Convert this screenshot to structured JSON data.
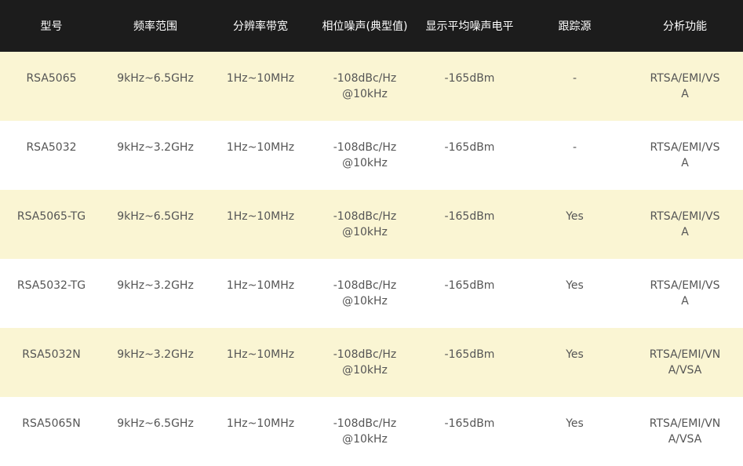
{
  "table": {
    "headers": [
      "型号",
      "频率范围",
      "分辨率带宽",
      "相位噪声(典型值)",
      "显示平均噪声电平",
      "跟踪源",
      "分析功能"
    ],
    "rows": [
      [
        "RSA5065",
        "9kHz~6.5GHz",
        "1Hz~10MHz",
        "-108dBc/Hz@10kHz",
        "-165dBm",
        "-",
        "RTSA/EMI/VSA"
      ],
      [
        "RSA5032",
        "9kHz~3.2GHz",
        "1Hz~10MHz",
        "-108dBc/Hz@10kHz",
        "-165dBm",
        "-",
        "RTSA/EMI/VSA"
      ],
      [
        "RSA5065-TG",
        "9kHz~6.5GHz",
        "1Hz~10MHz",
        "-108dBc/Hz@10kHz",
        "-165dBm",
        "Yes",
        "RTSA/EMI/VSA"
      ],
      [
        "RSA5032-TG",
        "9kHz~3.2GHz",
        "1Hz~10MHz",
        "-108dBc/Hz@10kHz",
        "-165dBm",
        "Yes",
        "RTSA/EMI/VSA"
      ],
      [
        "RSA5032N",
        "9kHz~3.2GHz",
        "1Hz~10MHz",
        "-108dBc/Hz@10kHz",
        "-165dBm",
        "Yes",
        "RTSA/EMI/VNA/VSA"
      ],
      [
        "RSA5065N",
        "9kHz~6.5GHz",
        "1Hz~10MHz",
        "-108dBc/Hz@10kHz",
        "-165dBm",
        "Yes",
        "RTSA/EMI/VNA/VSA"
      ]
    ]
  },
  "colors": {
    "header_bg": "#1c1c1c",
    "header_text": "#ffffff",
    "row_alt_bg": "#faf5d3",
    "row_bg": "#ffffff",
    "cell_text": "#555555"
  }
}
